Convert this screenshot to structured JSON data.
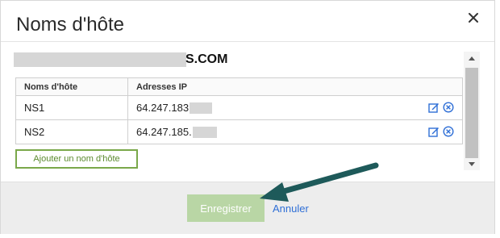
{
  "modal": {
    "title": "Noms d'hôte",
    "domain_suffix": "S.COM"
  },
  "table": {
    "headers": [
      "Noms d'hôte",
      "Adresses IP"
    ],
    "rows": [
      {
        "name": "NS1",
        "ip": "64.247.183"
      },
      {
        "name": "NS2",
        "ip": "64.247.185."
      }
    ]
  },
  "buttons": {
    "add_host": "Ajouter un nom d'hôte",
    "save": "Enregistrer",
    "cancel": "Annuler"
  },
  "colors": {
    "accent_green": "#7aa84a",
    "save_disabled": "#b9d6a5",
    "link_blue": "#2f6fd6",
    "arrow_teal": "#1e5a5a"
  },
  "icons": [
    "close-icon",
    "edit-icon",
    "delete-icon",
    "scroll-up-icon",
    "scroll-down-icon"
  ]
}
